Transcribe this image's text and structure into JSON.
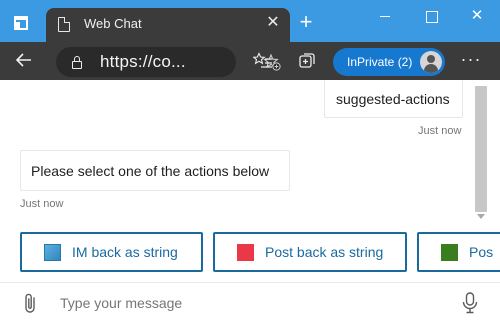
{
  "browser": {
    "tab_title": "Web Chat",
    "tab_close": "✕",
    "new_tab": "+",
    "window_close": "✕",
    "url": "https://co...",
    "inprivate_label": "InPrivate (2)",
    "more": "···"
  },
  "icons": {
    "tab_actions": "tab-actions-icon",
    "page": "page-icon",
    "back": "back-arrow-icon",
    "lock": "lock-icon",
    "add_favorite": "star-plus-icon",
    "favorites": "favorites-list-icon",
    "collections": "collections-icon",
    "attach": "paperclip-icon",
    "mic": "microphone-icon"
  },
  "chat": {
    "messages": [
      {
        "from": "user",
        "text": "suggested-actions",
        "timestamp": "Just now"
      },
      {
        "from": "bot",
        "text": "Please select one of the actions below",
        "timestamp": "Just now"
      }
    ],
    "suggested_actions": [
      {
        "label": "IM back as string",
        "color": "#3f9bd4"
      },
      {
        "label": "Post back as string",
        "color": "#ea3847"
      },
      {
        "label": "Pos",
        "color": "#3a7d1f"
      }
    ],
    "input_placeholder": "Type your message"
  },
  "colors": {
    "titlebar": "#3c9ae3",
    "toolbar": "#3b3b3b",
    "inprivate": "#1778d0",
    "action_border": "#1a6a9e"
  }
}
